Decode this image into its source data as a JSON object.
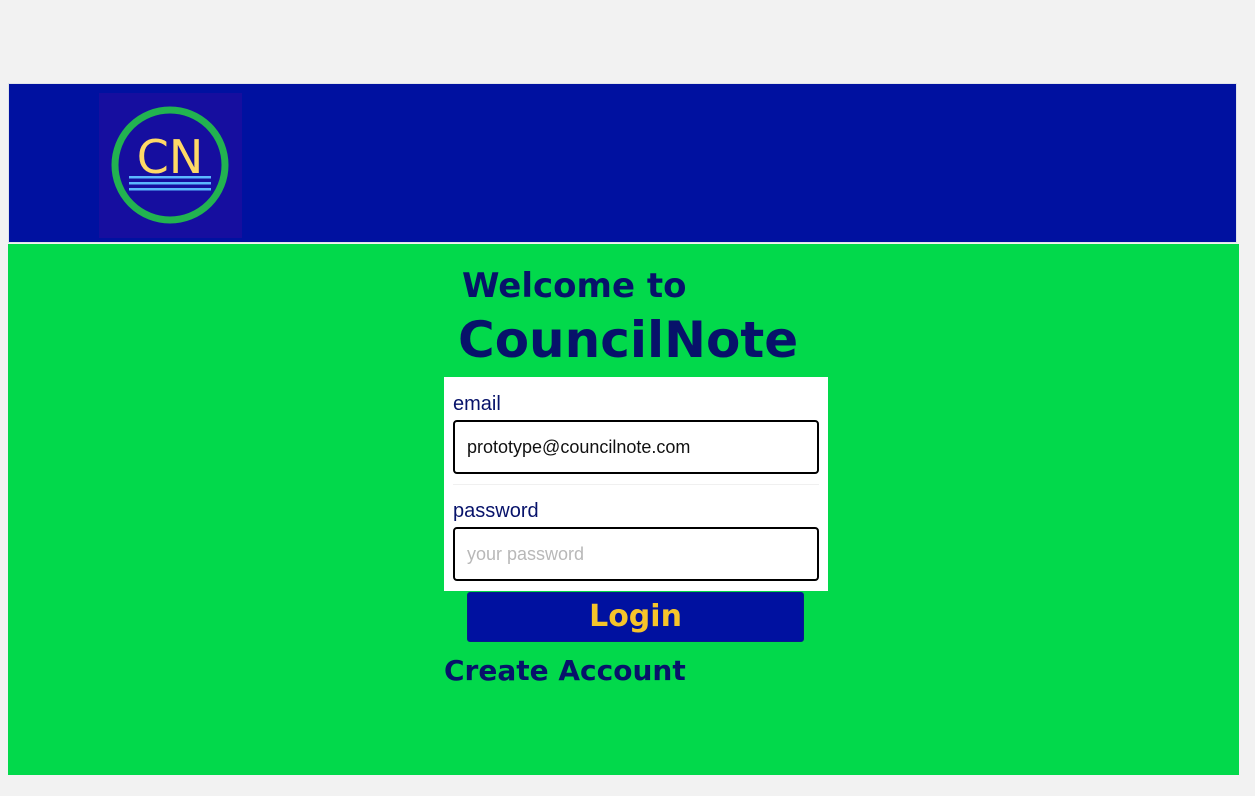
{
  "header": {
    "logo_text": "CN"
  },
  "login": {
    "welcome": "Welcome to",
    "app_name": "CouncilNote",
    "email_label": "email",
    "email_value": "prototype@councilnote.com",
    "password_label": "password",
    "password_placeholder": "your password",
    "login_button": "Login",
    "create_account": "Create Account"
  },
  "colors": {
    "header_bg": "#0011a0",
    "content_bg": "#02d94b",
    "text_primary": "#07126a",
    "button_text": "#f5c42a",
    "logo_ring": "#22b350",
    "logo_letters": "#ffd966"
  },
  "icons": {
    "logo": "councilnote-logo"
  }
}
